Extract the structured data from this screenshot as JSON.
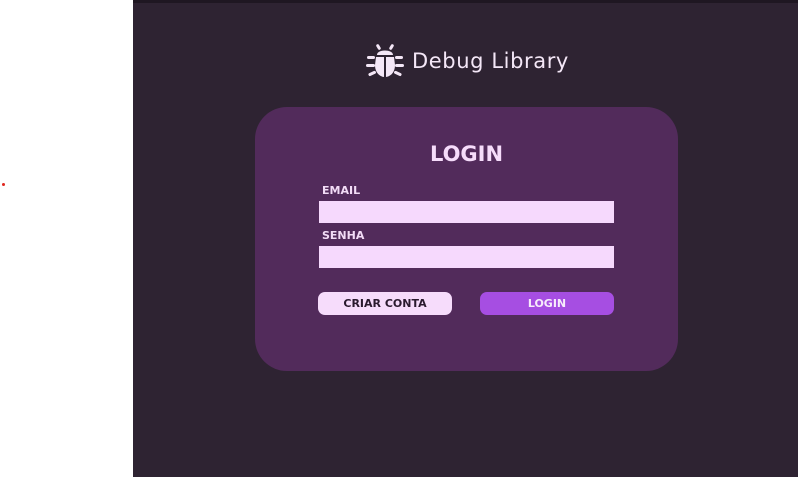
{
  "app": {
    "brand_title": "Debug Library",
    "brand_icon": "bug-icon"
  },
  "login_card": {
    "title": "LOGIN",
    "email_label": "EMAIL",
    "email_value": "",
    "password_label": "SENHA",
    "password_value": "",
    "create_account_label": "CRIAR CONTA",
    "login_label": "LOGIN"
  },
  "colors": {
    "background": "#2e2332",
    "card": "#522b5b",
    "input": "#f6d9fd",
    "primary_button": "#a64ee2",
    "secondary_button": "#f6dcfb",
    "text_light": "#f4e7f7"
  }
}
